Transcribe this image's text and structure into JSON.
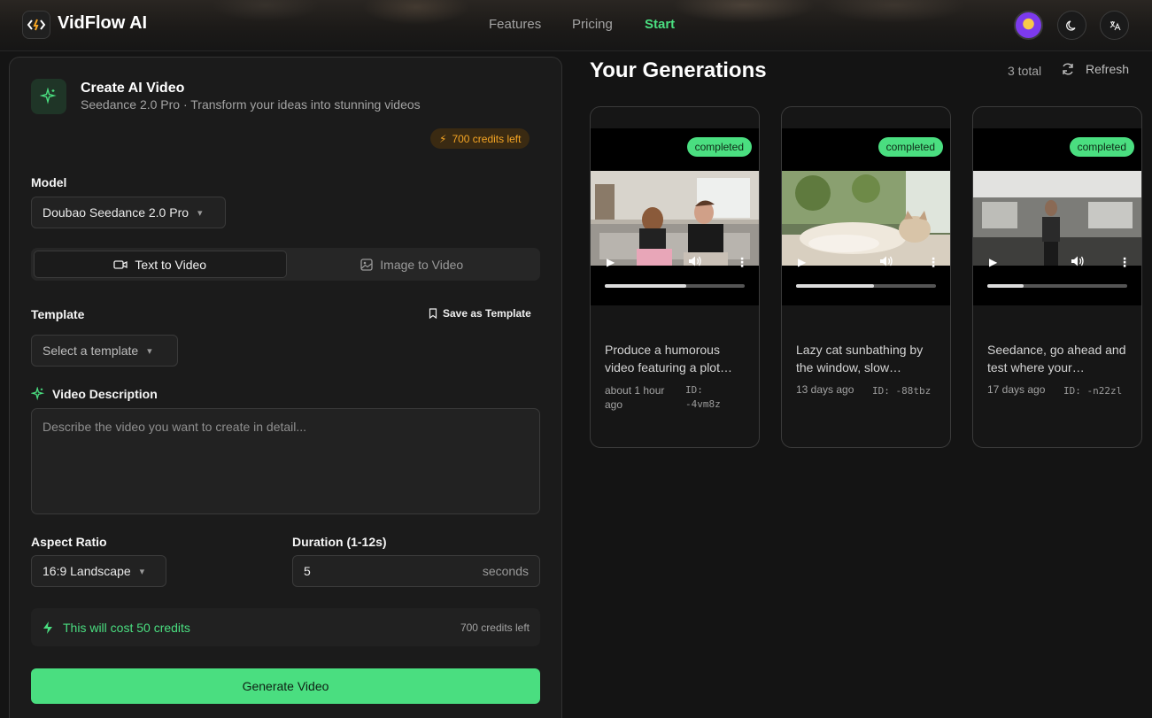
{
  "header": {
    "brand": "VidFlow AI",
    "nav": [
      {
        "label": "Features"
      },
      {
        "label": "Pricing"
      },
      {
        "label": "Start"
      }
    ]
  },
  "form": {
    "title": "Create AI Video",
    "subtitle": "Seedance 2.0 Pro · Transform your ideas into stunning videos",
    "credits_badge": "700 credits left",
    "model_label": "Model",
    "model_value": "Doubao Seedance 2.0 Pro",
    "tabs": [
      {
        "label": "Text to Video"
      },
      {
        "label": "Image to Video"
      }
    ],
    "template_label": "Template",
    "save_template": "Save as Template",
    "template_placeholder": "Select a template",
    "description_label": "Video Description",
    "description_placeholder": "Describe the video you want to create in detail...",
    "aspect_label": "Aspect Ratio",
    "aspect_value": "16:9 Landscape",
    "duration_label": "Duration (1-12s)",
    "duration_value": "5",
    "duration_unit": "seconds",
    "cost_text": "This will cost 50 credits",
    "cost_remaining": "700 credits left",
    "generate_button": "Generate Video"
  },
  "generations": {
    "title": "Your Generations",
    "total": "3 total",
    "refresh": "Refresh",
    "items": [
      {
        "status": "completed",
        "desc": "Produce a humorous video featuring a plot…",
        "time": "about 1 hour ago",
        "id": "ID: -4vm8z",
        "progress": 0.58
      },
      {
        "status": "completed",
        "desc": "Lazy cat sunbathing by the window, slow…",
        "time": "13 days ago",
        "id": "ID: -88tbz",
        "progress": 0.56
      },
      {
        "status": "completed",
        "desc": "Seedance, go ahead and test where your…",
        "time": "17 days ago",
        "id": "ID: -n22zl",
        "progress": 0.26
      }
    ]
  },
  "colors": {
    "accent": "#4ade80",
    "warning": "#f5a524",
    "background": "#141414"
  }
}
